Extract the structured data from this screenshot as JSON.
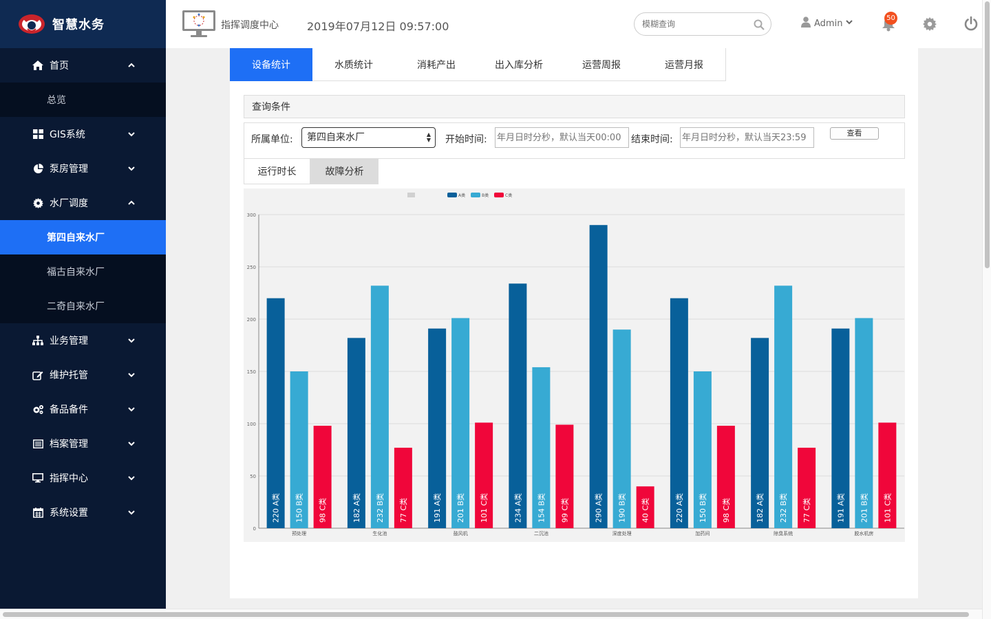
{
  "brand": {
    "title": "智慧水务"
  },
  "sidebar": {
    "items": [
      {
        "label": "首页",
        "icon": "home-icon",
        "expanded": true,
        "subitems": [
          {
            "label": "总览",
            "active": false
          }
        ]
      },
      {
        "label": "GIS系统",
        "icon": "grid-icon",
        "expanded": false
      },
      {
        "label": "泵房管理",
        "icon": "pie-chart-icon",
        "expanded": false
      },
      {
        "label": "水厂调度",
        "icon": "gear-icon",
        "expanded": true,
        "subitems": [
          {
            "label": "第四自来水厂",
            "active": true
          },
          {
            "label": "福古自来水厂",
            "active": false
          },
          {
            "label": "二奇自来水厂",
            "active": false
          }
        ]
      },
      {
        "label": "业务管理",
        "icon": "sitemap-icon",
        "expanded": false
      },
      {
        "label": "维护托管",
        "icon": "edit-icon",
        "expanded": false
      },
      {
        "label": "备品备件",
        "icon": "gears-icon",
        "expanded": false
      },
      {
        "label": "档案管理",
        "icon": "list-icon",
        "expanded": false
      },
      {
        "label": "指挥中心",
        "icon": "desktop-icon",
        "expanded": false
      },
      {
        "label": "系统设置",
        "icon": "calendar-icon",
        "expanded": false
      }
    ]
  },
  "header": {
    "title": "指挥调度中心",
    "datetime": "2019年07月12日 09:57:00",
    "search_placeholder": "模糊查询",
    "user": "Admin",
    "notification_count": "50"
  },
  "tabs": [
    {
      "label": "设备统计",
      "active": true
    },
    {
      "label": "水质统计",
      "active": false
    },
    {
      "label": "消耗产出",
      "active": false
    },
    {
      "label": "出入库分析",
      "active": false
    },
    {
      "label": "运营周报",
      "active": false
    },
    {
      "label": "运营月报",
      "active": false
    }
  ],
  "query": {
    "panel_title": "查询条件",
    "unit_label": "所属单位:",
    "unit_value": "第四自来水厂",
    "start_label": "开始时间:",
    "start_placeholder": "年月日时分秒，默认当天00:00",
    "end_label": "结束时间:",
    "end_placeholder": "年月日时分秒，默认当天23:59",
    "button": "查看"
  },
  "subtabs": [
    {
      "label": "运行时长",
      "active": false
    },
    {
      "label": "故障分析",
      "active": true
    }
  ],
  "colors": {
    "primary": "#1e6ff5",
    "sidebar": "#0a1933",
    "seriesA": "#08609a",
    "seriesB": "#37aad3",
    "seriesC": "#f0063a"
  },
  "chart_data": {
    "type": "bar",
    "categories": [
      "预处理",
      "生化池",
      "鼓风机",
      "二沉池",
      "深度处理",
      "加药间",
      "除臭系统",
      "脱水机房"
    ],
    "series": [
      {
        "name": "A类",
        "values": [
          220,
          182,
          191,
          234,
          290,
          220,
          182,
          191
        ]
      },
      {
        "name": "B类",
        "values": [
          150,
          232,
          201,
          154,
          190,
          150,
          232,
          201
        ]
      },
      {
        "name": "C类",
        "values": [
          98,
          77,
          101,
          99,
          40,
          98,
          77,
          101
        ]
      }
    ],
    "bar_label_suffixes": [
      "A类",
      "B类",
      "C类"
    ],
    "ylim": [
      0,
      300
    ],
    "yticks": [
      0,
      50,
      100,
      150,
      200,
      250,
      300
    ],
    "grid": true,
    "legend": "top-center"
  }
}
